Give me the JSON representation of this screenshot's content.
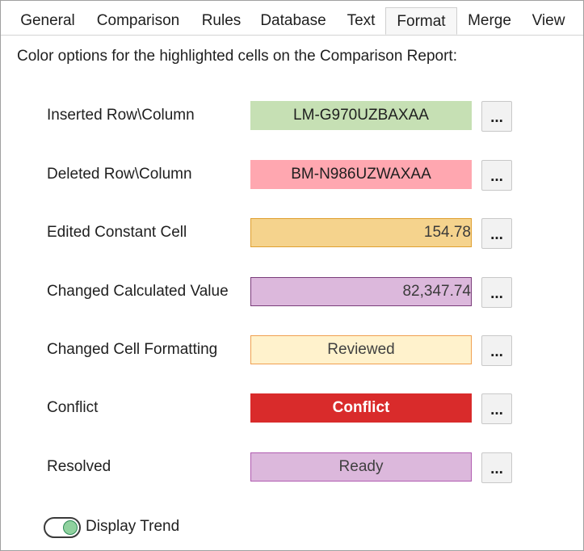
{
  "tabs": [
    {
      "label": "General"
    },
    {
      "label": "Comparison"
    },
    {
      "label": "Rules"
    },
    {
      "label": "Database"
    },
    {
      "label": "Text"
    },
    {
      "label": "Format",
      "active": true
    },
    {
      "label": "Merge"
    },
    {
      "label": "View"
    }
  ],
  "intro_text": "Color options for the highlighted cells on the Comparison Report:",
  "rows": [
    {
      "label": "Inserted Row\\Column",
      "sample": "LM-G970UZBAXAA",
      "bg": "#c6e0b4",
      "border": "#c6e0b4",
      "text_color": "#1f1f1f",
      "align": "center",
      "bold": false
    },
    {
      "label": "Deleted Row\\Column",
      "sample": "BM-N986UZWAXAA",
      "bg": "#ffa7b0",
      "border": "#ffa7b0",
      "text_color": "#1f1f1f",
      "align": "center",
      "bold": false
    },
    {
      "label": "Edited Constant Cell",
      "sample": "154.78",
      "bg": "#f5d38d",
      "border": "#e0a030",
      "text_color": "#3a3a3a",
      "align": "right",
      "bold": false
    },
    {
      "label": "Changed Calculated Value",
      "sample": "82,347.74",
      "bg": "#dcb8dc",
      "border": "#7a3c7a",
      "text_color": "#3a3a3a",
      "align": "right",
      "bold": false
    },
    {
      "label": "Changed Cell Formatting",
      "sample": "Reviewed",
      "bg": "#fff2cc",
      "border": "#f0a050",
      "text_color": "#404040",
      "align": "center",
      "bold": false
    },
    {
      "label": "Conflict",
      "sample": "Conflict",
      "bg": "#d92b2b",
      "border": "#d92b2b",
      "text_color": "#ffffff",
      "align": "center",
      "bold": true
    },
    {
      "label": "Resolved",
      "sample": "Ready",
      "bg": "#dcb8dc",
      "border": "#b05cb0",
      "text_color": "#404040",
      "align": "center",
      "bold": false
    }
  ],
  "picker_button_label": "...",
  "display_trend": {
    "label": "Display Trend",
    "on": true
  }
}
